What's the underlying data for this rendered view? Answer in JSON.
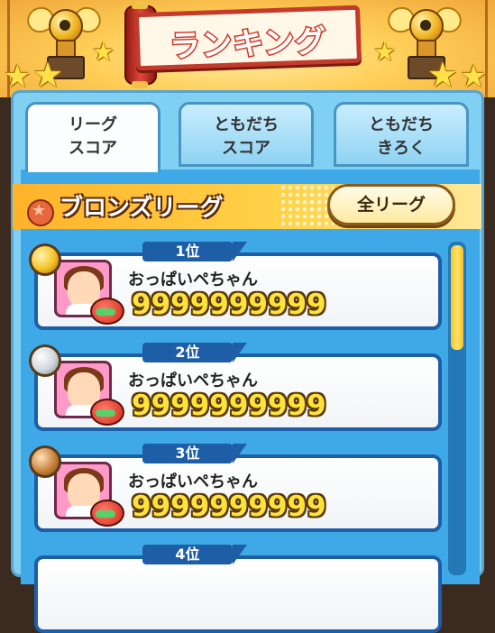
{
  "header": {
    "title": "ランキング"
  },
  "tabs": [
    {
      "label": "リーグ\nスコア",
      "active": true
    },
    {
      "label": "ともだち\nスコア",
      "active": false
    },
    {
      "label": "ともだち\nきろく",
      "active": false
    }
  ],
  "league": {
    "name": "ブロンズリーグ",
    "all_league_button": "全リーグ"
  },
  "rankings": [
    {
      "rank": "1位",
      "name": "おっぱいペちゃん",
      "score": "9999999999",
      "medal": "gold"
    },
    {
      "rank": "2位",
      "name": "おっぱいペちゃん",
      "score": "9999999999",
      "medal": "silver"
    },
    {
      "rank": "3位",
      "name": "おっぱいペちゃん",
      "score": "9999999999",
      "medal": "bronze"
    },
    {
      "rank": "4位"
    }
  ],
  "colors": {
    "gold": "#f5c227",
    "silver": "#cfd6dc",
    "bronze": "#c9823e",
    "card_border": "#1d5ea6",
    "score_fill": "#ffe23a"
  },
  "scroll": {
    "position_fraction": 0.0
  }
}
